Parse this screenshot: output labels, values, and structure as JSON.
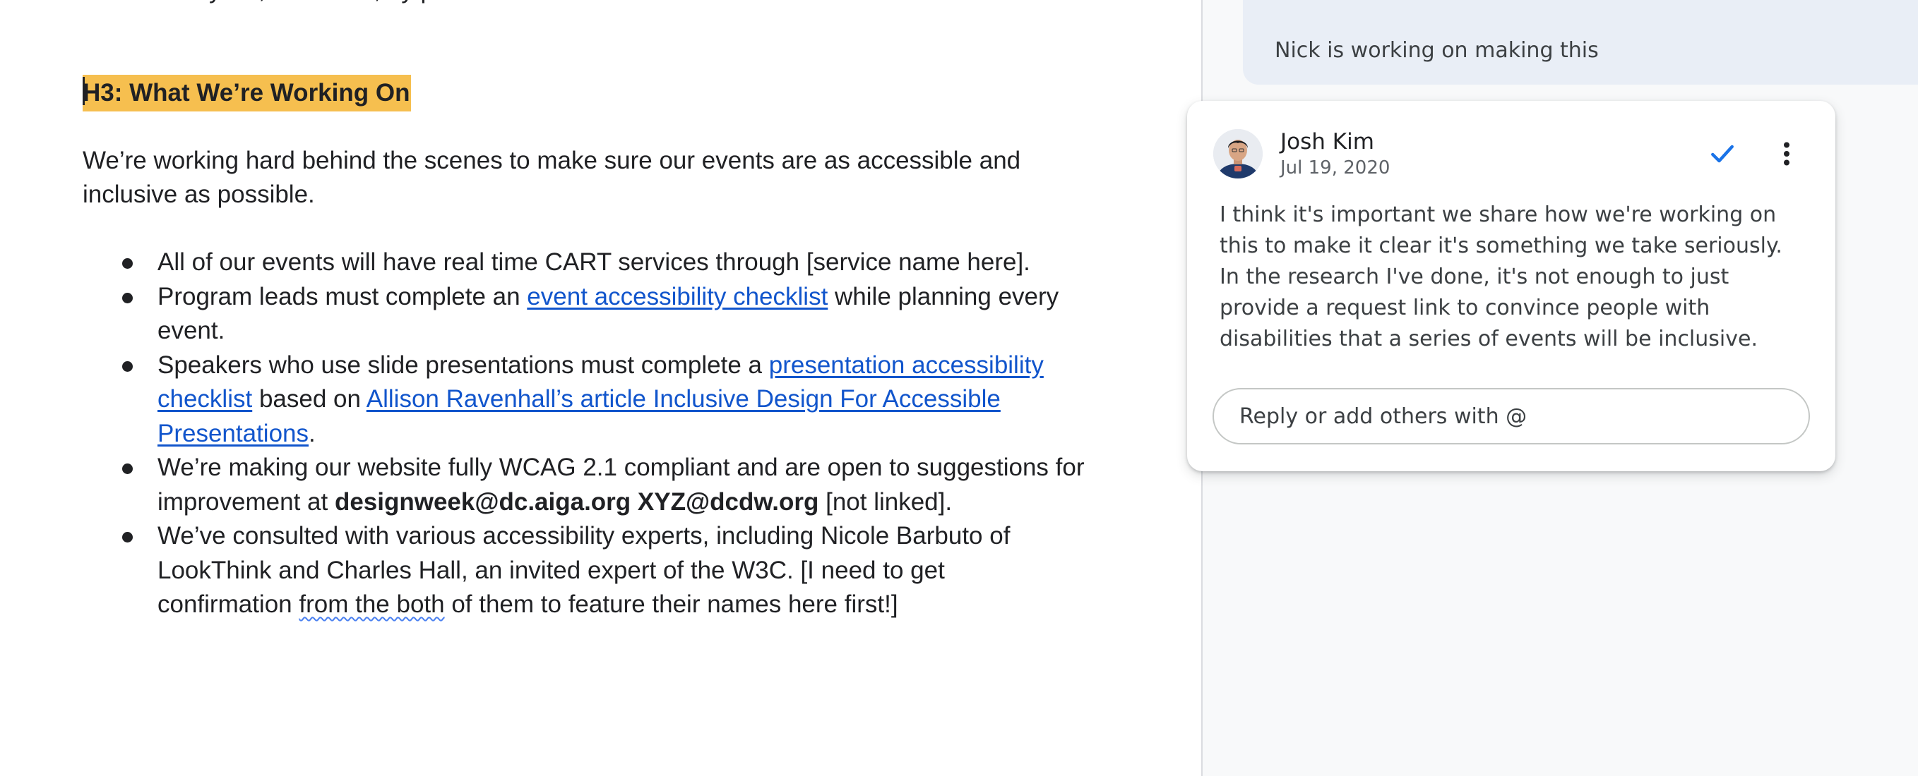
{
  "document": {
    "clipped_line": "…which fully list, the event, by plan",
    "heading": "H3: What We’re Working On",
    "intro": "We’re working hard behind the scenes to make sure our events are as accessible and inclusive as possible.",
    "bullets": [
      {
        "text": "All of our events will have real time CART services through [service name here]."
      },
      {
        "pre": "Program leads must complete an ",
        "link": "event accessibility checklist",
        "post": " while planning every event."
      },
      {
        "pre": "Speakers who use slide presentations must complete a ",
        "link1": "presentation accessibility checklist",
        "mid": " based on ",
        "link2": "Allison Ravenhall’s article Inclusive Design For Accessible Presentations",
        "post": "."
      },
      {
        "pre": "We’re making our website fully WCAG 2.1 compliant and are open to suggestions for improvement at ",
        "bold": "designweek@dc.aiga.org XYZ@dcdw.org",
        "post": " [not linked]."
      },
      {
        "pre": "We’ve consulted with various accessibility experts, including Nicole Barbuto of LookThink and Charles Hall, an invited expert of the W3C. [I need to get confirmation ",
        "flagged": "from the both",
        "post": " of them to feature their names here first!]"
      }
    ]
  },
  "comments": {
    "previous_text": "Nick is working on making this",
    "active": {
      "author": "Josh Kim",
      "date": "Jul 19, 2020",
      "body": "I think it's important we share how we're working on this to make it clear it's something we take seriously. In the research I've done, it's not enough to just provide a request link to convince people with disabilities that a series of events will be inclusive.",
      "reply_placeholder": "Reply or add others with @"
    }
  },
  "colors": {
    "heading_highlight": "#f6bf4f",
    "link": "#1155cc",
    "resolve_check": "#1a73e8",
    "sidebar_bg": "#f8f9fa",
    "previous_comment_bg": "#e9eef6"
  },
  "icons": {
    "resolve": "check-icon",
    "more": "more-vert-icon"
  }
}
